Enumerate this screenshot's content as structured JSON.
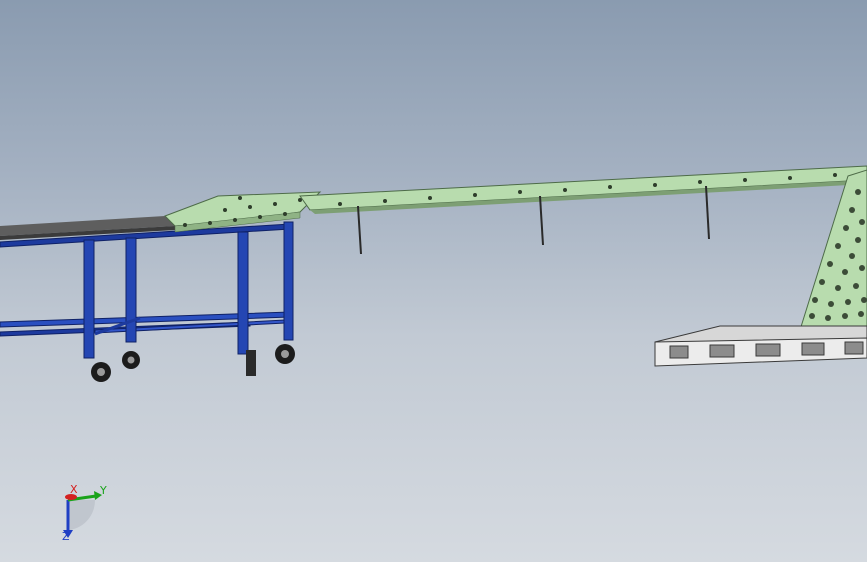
{
  "viewport": {
    "background_top": "#8a9bb0",
    "background_bottom": "#d5dae0"
  },
  "colors": {
    "frame_blue": "#1d3a9e",
    "frame_blue_dark": "#0f2166",
    "conveyor_green": "#b8dcae",
    "conveyor_edge": "#4d6b48",
    "table_top": "#6f6f6f",
    "pallet": "#e9e9e9",
    "axis_x": "#d42020",
    "axis_y": "#1aa31a",
    "axis_z": "#1f3fc4"
  },
  "triad": {
    "x_label": "X",
    "y_label": "Y",
    "z_label": "Z"
  }
}
